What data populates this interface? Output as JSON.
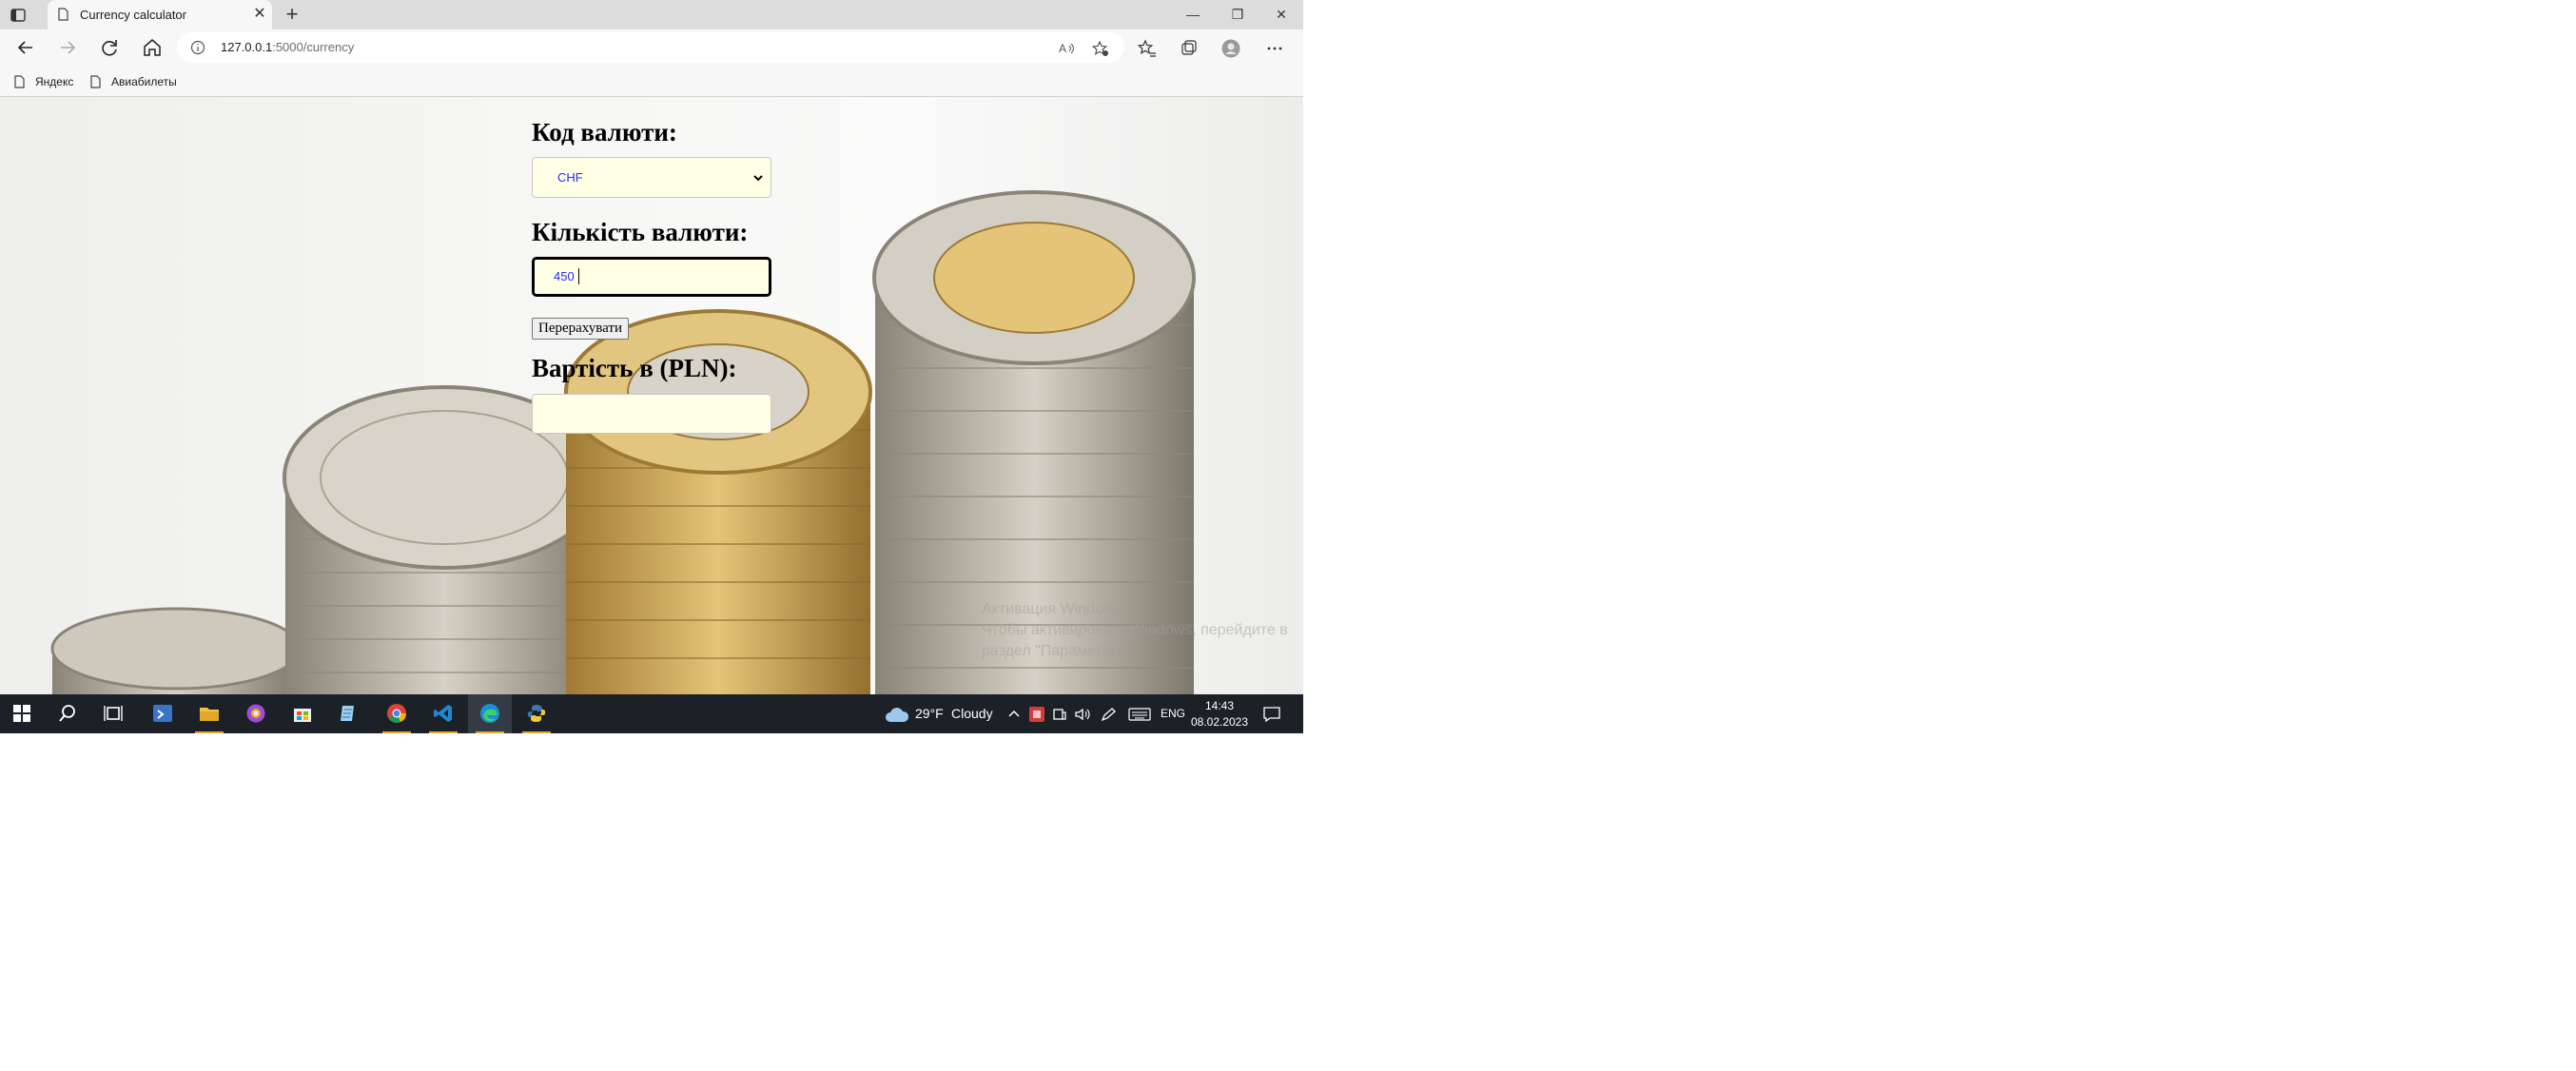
{
  "browser": {
    "tab_title": "Currency calculator",
    "new_tab_label": "+",
    "url_host": "127.0.0.1",
    "url_path": ":5000/currency",
    "window_controls": [
      "minimize-icon",
      "restore-icon",
      "close-icon"
    ]
  },
  "bookmarks": [
    {
      "label": "Яндекс",
      "icon": "page-icon"
    },
    {
      "label": "Авиабилеты",
      "icon": "page-icon"
    }
  ],
  "form": {
    "currency_label": "Код валюти:",
    "currency_value": "CHF",
    "amount_label": "Кількість валюти:",
    "amount_value": "450",
    "recalc_button": "Перерахувати",
    "result_label": "Вартість в (PLN):",
    "result_value": ""
  },
  "watermark": {
    "line1": "Активация Windows",
    "line2": "Чтобы активировать Windows, перейдите в раздел \"Параметры\"."
  },
  "taskbar": {
    "weather_temp": "29°F",
    "weather_text": "Cloudy",
    "language": "ENG",
    "time": "14:43",
    "date": "08.02.2023",
    "accent_color": "#e5a93a"
  }
}
